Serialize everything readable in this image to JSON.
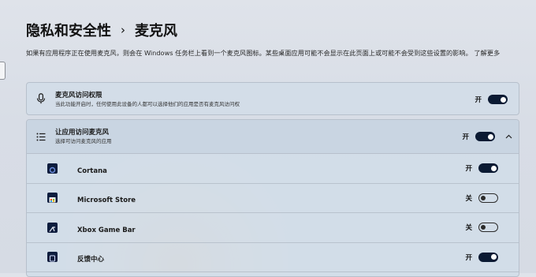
{
  "breadcrumb": {
    "parent": "隐私和安全性",
    "separator": "›",
    "current": "麦克风"
  },
  "description": "如果有应用程序正在使用麦克风，则会在 Windows 任务栏上看到一个麦克风图标。某些桌面应用可能不会显示在此页面上或可能不会受到这些设置的影响。",
  "learn_more": "了解更多",
  "mic_access": {
    "title": "麦克风访问权限",
    "subtitle": "当此功能开启时，任何使用此设备的人都可以选择他们的应用是否有麦克风访问权",
    "state": "开",
    "on": true,
    "icon": "microphone-icon"
  },
  "app_access": {
    "title": "让应用访问麦克风",
    "subtitle": "选择可访问麦克风的应用",
    "state": "开",
    "on": true,
    "icon": "list-icon",
    "expanded": true
  },
  "apps": [
    {
      "name": "Cortana",
      "state": "开",
      "on": true,
      "icon": "cortana-icon"
    },
    {
      "name": "Microsoft Store",
      "state": "关",
      "on": false,
      "icon": "store-icon"
    },
    {
      "name": "Xbox Game Bar",
      "state": "关",
      "on": false,
      "icon": "xbox-game-bar-icon"
    },
    {
      "name": "反馈中心",
      "state": "开",
      "on": true,
      "icon": "feedback-hub-icon"
    }
  ]
}
